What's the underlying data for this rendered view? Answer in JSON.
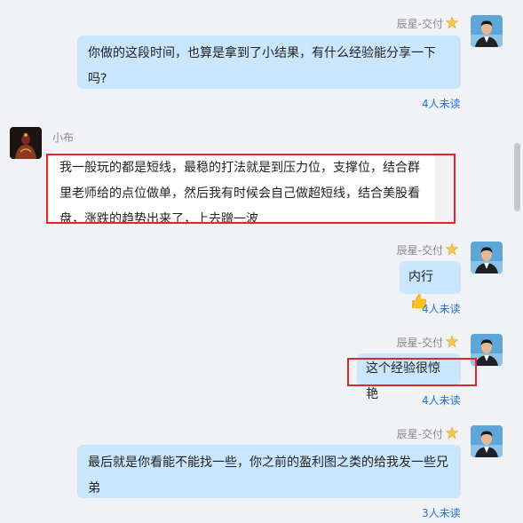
{
  "messages": [
    {
      "side": "right",
      "sender": "辰星-交付",
      "badge_icon": "crown-icon",
      "avatar_icon": "man-in-suit-avatar",
      "text": "你做的这段时间，也算是拿到了小结果，有什么经验能分享一下吗?",
      "read_status": "4人未读"
    },
    {
      "side": "left",
      "sender": "小布",
      "avatar_icon": "dark-figure-avatar",
      "text": "我一般玩的都是短线，最稳的打法就是到压力位，支撑位，结合群里老师给的点位做单，然后我有时候会自己做超短线，结合美股看盘，涨跌的趋势出来了，上去蹭一波"
    },
    {
      "side": "right",
      "sender": "辰星-交付",
      "badge_icon": "crown-icon",
      "avatar_icon": "man-in-suit-avatar",
      "text": "内行",
      "emoji_icon": "thumbs-up-icon",
      "read_status": "4人未读"
    },
    {
      "side": "right",
      "sender": "辰星-交付",
      "badge_icon": "crown-icon",
      "avatar_icon": "man-in-suit-avatar",
      "text": "这个经验很惊艳",
      "read_status": "4人未读"
    },
    {
      "side": "right",
      "sender": "辰星-交付",
      "badge_icon": "crown-icon",
      "avatar_icon": "man-in-suit-avatar",
      "text": "最后就是你看能不能找一些，你之前的盈利图之类的给我发一些兄弟",
      "read_status": "3人未读"
    }
  ],
  "colors": {
    "background": "#f1f2f5",
    "my_bubble": "#c9e6fc",
    "their_bubble": "#ffffff",
    "read_status": "#1a73d9",
    "highlight": "#e0262b"
  }
}
